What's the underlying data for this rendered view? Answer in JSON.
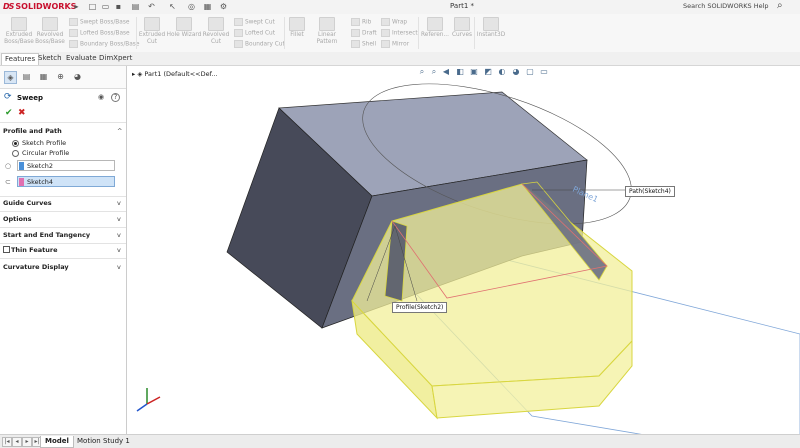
{
  "app": {
    "brand": "SOLIDWORKS",
    "document_title": "Part1 *",
    "search_placeholder": "Search SOLIDWORKS Help"
  },
  "ribbon": {
    "extruded_boss": "Extruded\nBoss/Base",
    "revolved_boss": "Revolved\nBoss/Base",
    "swept_boss": "Swept Boss/Base",
    "lofted_boss": "Lofted Boss/Base",
    "boundary_boss": "Boundary Boss/Base",
    "extruded_cut": "Extruded\nCut",
    "hole_wizard": "Hole Wizard",
    "revolved_cut": "Revolved\nCut",
    "swept_cut": "Swept Cut",
    "lofted_cut": "Lofted Cut",
    "boundary_cut": "Boundary Cut",
    "fillet": "Fillet",
    "linear_pattern": "Linear Pattern",
    "rib": "Rib",
    "draft": "Draft",
    "shell": "Shell",
    "wrap": "Wrap",
    "intersect": "Intersect",
    "mirror": "Mirror",
    "reference": "Referen...",
    "curves": "Curves",
    "instant3d": "Instant3D"
  },
  "tabs": [
    "Features",
    "Sketch",
    "Evaluate",
    "DimXpert"
  ],
  "property_manager": {
    "title": "Sweep",
    "sections": {
      "profile_and_path": "Profile and Path",
      "guide_curves": "Guide Curves",
      "options": "Options",
      "start_end_tangency": "Start and End Tangency",
      "thin_feature": "Thin Feature",
      "curvature_display": "Curvature Display"
    },
    "radio_sketch_profile": "Sketch Profile",
    "radio_circular_profile": "Circular Profile",
    "profile_field": "Sketch2",
    "path_field": "Sketch4",
    "profile_color": "#4a90d9",
    "path_color": "#e070b0"
  },
  "tree": {
    "root": "Part1  (Default<<Def..."
  },
  "callouts": {
    "path": "Path(Sketch4)",
    "profile": "Profile(Sketch2)",
    "plane": "Plane1"
  },
  "bottom_tabs": [
    "Model",
    "Motion Study 1"
  ]
}
